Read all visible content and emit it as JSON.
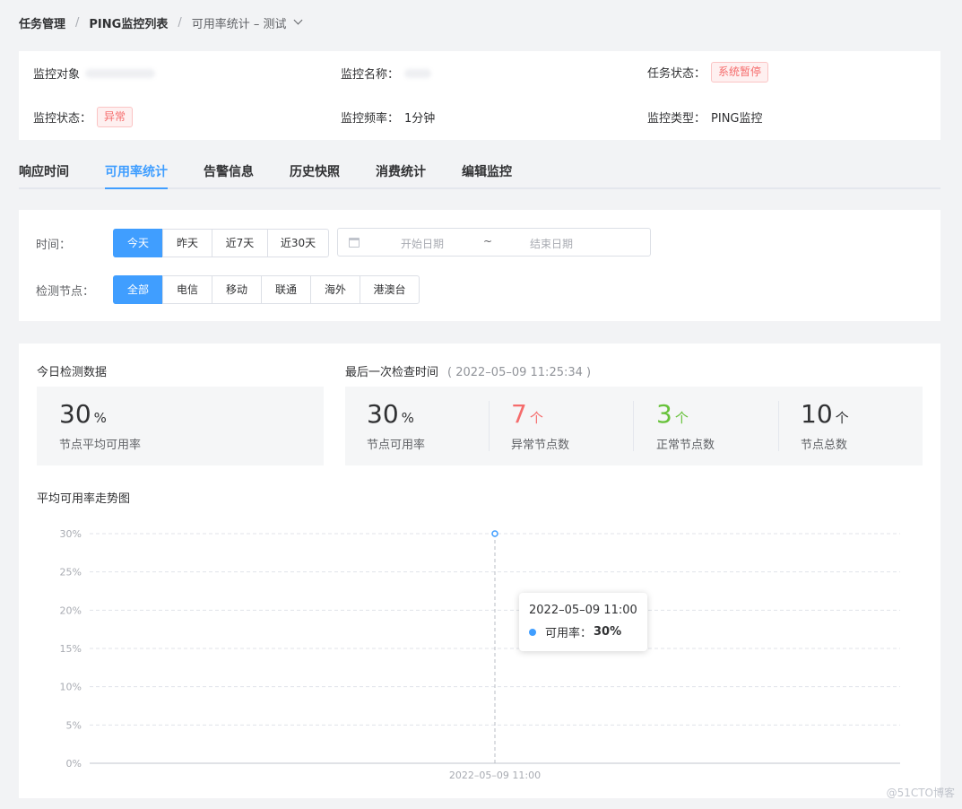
{
  "breadcrumb": {
    "item1": "任务管理",
    "item2": "PING监控列表",
    "current": "可用率统计 – 测试",
    "sep": "/"
  },
  "info": {
    "target_label": "监控对象",
    "name_label": "监控名称：",
    "task_status_label": "任务状态：",
    "task_status": "系统暂停",
    "monitor_status_label": "监控状态：",
    "monitor_status": "异常",
    "frequency_label": "监控频率：",
    "frequency": "1分钟",
    "type_label": "监控类型：",
    "type": "PING监控"
  },
  "tabs": [
    "响应时间",
    "可用率统计",
    "告警信息",
    "历史快照",
    "消费统计",
    "编辑监控"
  ],
  "filter": {
    "time_label": "时间：",
    "time_options": [
      "今天",
      "昨天",
      "近7天",
      "近30天"
    ],
    "start_placeholder": "开始日期",
    "range_sep": "~",
    "end_placeholder": "结束日期",
    "node_label": "检测节点：",
    "node_options": [
      "全部",
      "电信",
      "移动",
      "联通",
      "海外",
      "港澳台"
    ]
  },
  "today": {
    "title": "今日检测数据",
    "avg_value": "30",
    "avg_unit": "%",
    "avg_label": "节点平均可用率"
  },
  "last_check": {
    "title": "最后一次检查时间",
    "time": "( 2022–05–09 11:25:34 )",
    "availability_value": "30",
    "availability_unit": "%",
    "availability_label": "节点可用率",
    "abnormal_value": "7",
    "abnormal_unit": "个",
    "abnormal_label": "异常节点数",
    "normal_value": "3",
    "normal_unit": "个",
    "normal_label": "正常节点数",
    "total_value": "10",
    "total_unit": "个",
    "total_label": "节点总数"
  },
  "chart": {
    "title": "平均可用率走势图",
    "tooltip_time": "2022–05–09 11:00",
    "tooltip_label": "可用率：",
    "tooltip_value": "30%"
  },
  "chart_data": {
    "type": "line",
    "title": "平均可用率走势图",
    "x": [
      "2022–05–09 11:00"
    ],
    "series": [
      {
        "name": "可用率",
        "values": [
          30
        ]
      }
    ],
    "ylim": [
      0,
      30
    ],
    "yticks": [
      "0%",
      "5%",
      "10%",
      "15%",
      "20%",
      "25%",
      "30%"
    ],
    "grid": true,
    "color": "#409eff"
  },
  "colors": {
    "accent": "#409eff",
    "danger": "#f56c6c",
    "success": "#67c23a"
  },
  "watermark": "@51CTO博客"
}
